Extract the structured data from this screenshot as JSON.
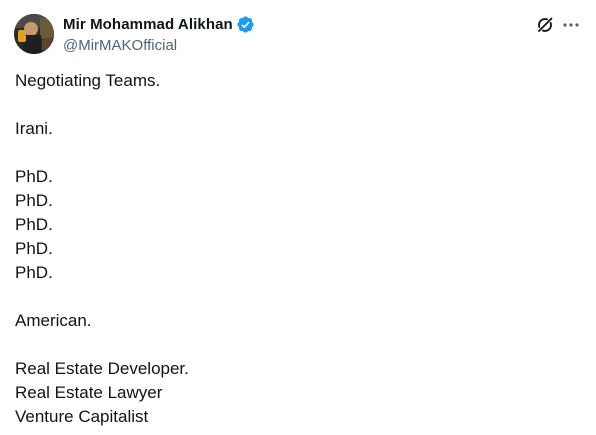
{
  "author": {
    "name": "Mir Mohammad Alikhan",
    "handle": "@MirMAKOfficial",
    "verified": true,
    "verified_color": "#1d9bf0"
  },
  "actions": {
    "grok_icon": "grok-icon",
    "more_icon": "more-horizontal-icon"
  },
  "tweet": {
    "lines": [
      "Negotiating Teams.",
      "",
      "Irani.",
      "",
      "PhD.",
      "PhD.",
      "PhD.",
      "PhD.",
      "PhD.",
      "",
      "American.",
      "",
      "Real Estate Developer.",
      "Real Estate Lawyer",
      "Venture Capitalist"
    ]
  }
}
